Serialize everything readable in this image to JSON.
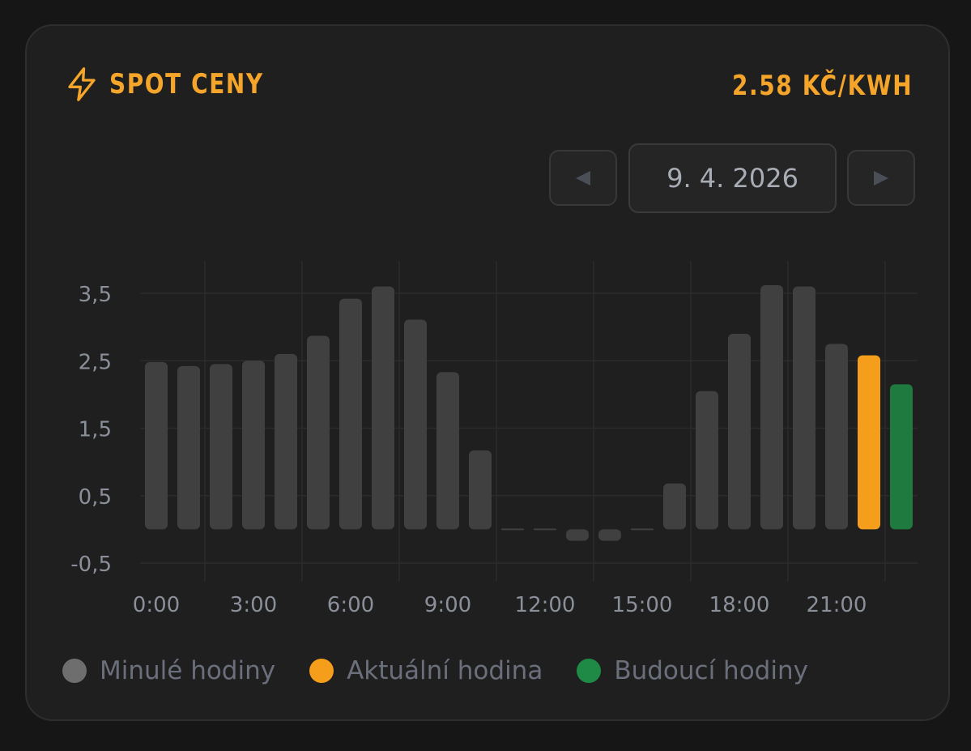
{
  "header": {
    "title": "SPOT CENY",
    "icon": "bolt-icon",
    "current_price": "2.58 KČ/KWH",
    "accent_color": "#f4a52a"
  },
  "date_nav": {
    "prev_icon": "triangle-left-icon",
    "next_icon": "triangle-right-icon",
    "date": "9. 4. 2026"
  },
  "legend": {
    "past_label": "Minulé hodiny",
    "current_label": "Aktuální hodina",
    "future_label": "Budoucí hodiny"
  },
  "chart_data": {
    "type": "bar",
    "categories": [
      "0:00",
      "1:00",
      "2:00",
      "3:00",
      "4:00",
      "5:00",
      "6:00",
      "7:00",
      "8:00",
      "9:00",
      "10:00",
      "11:00",
      "12:00",
      "13:00",
      "14:00",
      "15:00",
      "16:00",
      "17:00",
      "18:00",
      "19:00",
      "20:00",
      "21:00",
      "22:00",
      "23:00"
    ],
    "x_tick_labels": [
      "0:00",
      "3:00",
      "6:00",
      "9:00",
      "12:00",
      "15:00",
      "18:00",
      "21:00"
    ],
    "values": [
      2.48,
      2.42,
      2.45,
      2.5,
      2.6,
      2.87,
      3.42,
      3.6,
      3.11,
      2.33,
      1.17,
      0.01,
      0.0,
      -0.17,
      -0.17,
      -0.01,
      0.68,
      2.05,
      2.9,
      3.62,
      3.6,
      2.75,
      2.58,
      2.15
    ],
    "status": [
      "past",
      "past",
      "past",
      "past",
      "past",
      "past",
      "past",
      "past",
      "past",
      "past",
      "past",
      "past",
      "past",
      "past",
      "past",
      "past",
      "past",
      "past",
      "past",
      "past",
      "past",
      "past",
      "current",
      "future"
    ],
    "y_tick_labels": [
      "3,5",
      "2,5",
      "1,5",
      "0,5",
      "-0,5"
    ],
    "y_ticks": [
      3.5,
      2.5,
      1.5,
      0.5,
      -0.5
    ],
    "ylim": [
      -0.5,
      3.9
    ],
    "grid": true,
    "legend_position": "bottom-left",
    "colors": {
      "past": "#404040",
      "current": "#f59e1b",
      "future": "#1e7a3f",
      "grid": "#2b2b2b",
      "tick_text": "#8a8f99"
    }
  }
}
